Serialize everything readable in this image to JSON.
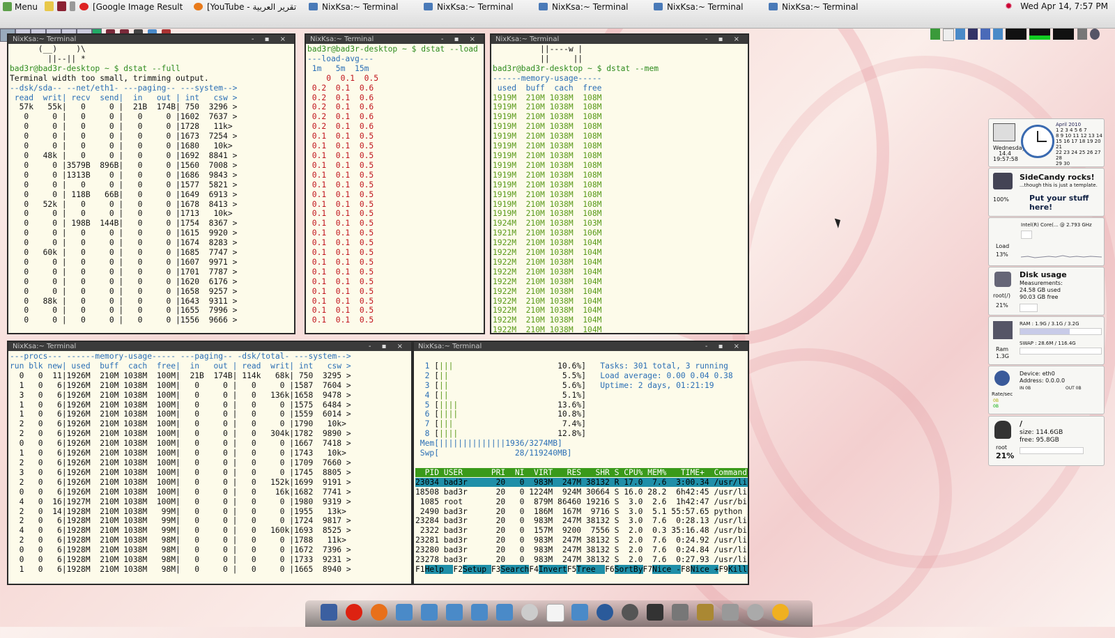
{
  "panel": {
    "menu_label": "Menu",
    "tasks": [
      {
        "label": "[Google Image Result ..."
      },
      {
        "label": "[YouTube - تقرير العربية ..."
      },
      {
        "label": "NixKsa:~ Terminal"
      },
      {
        "label": "NixKsa:~ Terminal"
      },
      {
        "label": "NixKsa:~ Terminal"
      },
      {
        "label": "NixKsa:~ Terminal"
      },
      {
        "label": "NixKsa:~ Terminal"
      }
    ],
    "clock": "Wed Apr 14,  7:57 PM"
  },
  "terminals": {
    "t1": {
      "title": "NixKsa:~ Terminal",
      "lines": [
        "      (__)    )\\",
        "        ||--|| *",
        "bad3r@bad3r-desktop ~ $ dstat --full",
        "Terminal width too small, trimming output.",
        "--dsk/sda-- --net/eth1- ---paging-- ---system-->",
        " read  writ| recv  send|  in   out | int   csw >",
        "  57k   55k|   0     0 |  21B  174B| 750  3296 >",
        "   0     0 |   0     0 |   0     0 |1602  7637 >",
        "   0     0 |   0     0 |   0     0 |1728   11k>",
        "   0     0 |   0     0 |   0     0 |1673  7254 >",
        "   0     0 |   0     0 |   0     0 |1680   10k>",
        "   0   48k |   0     0 |   0     0 |1692  8841 >",
        "   0     0 |3579B  896B|   0     0 |1560  7008 >",
        "   0     0 |1313B    0 |   0     0 |1686  9843 >",
        "   0     0 |   0     0 |   0     0 |1577  5821 >",
        "   0     0 | 118B   66B|   0     0 |1649  6913 >",
        "   0   52k |   0     0 |   0     0 |1678  8413 >",
        "   0     0 |   0     0 |   0     0 |1713   10k>",
        "   0     0 | 198B  144B|   0     0 |1754  8367 >",
        "   0     0 |   0     0 |   0     0 |1615  9920 >",
        "   0     0 |   0     0 |   0     0 |1674  8283 >",
        "   0   60k |   0     0 |   0     0 |1685  7747 >",
        "   0     0 |   0     0 |   0     0 |1607  9971 >",
        "   0     0 |   0     0 |   0     0 |1701  7787 >",
        "   0     0 |   0     0 |   0     0 |1620  6176 >",
        "   0     0 |   0     0 |   0     0 |1658  9257 >",
        "   0   88k |   0     0 |   0     0 |1643  9311 >",
        "   0     0 |   0     0 |   0     0 |1655  7996 >",
        "   0     0 |   0     0 |   0     0 |1556  9666 >"
      ]
    },
    "t2": {
      "title": "NixKsa:~ Terminal",
      "prompt": "bad3r@bad3r-desktop ~ $ dstat --load",
      "header1": "---load-avg---",
      "header2": " 1m   5m  15m ",
      "rows": [
        "   0  0.1  0.5",
        "0.2  0.1  0.6",
        "0.2  0.1  0.6",
        "0.2  0.1  0.6",
        "0.2  0.1  0.6",
        "0.2  0.1  0.6",
        "0.1  0.1  0.5",
        "0.1  0.1  0.5",
        "0.1  0.1  0.5",
        "0.1  0.1  0.5",
        "0.1  0.1  0.5",
        "0.1  0.1  0.5",
        "0.1  0.1  0.5",
        "0.1  0.1  0.5",
        "0.1  0.1  0.5",
        "0.1  0.1  0.5",
        "0.1  0.1  0.5",
        "0.1  0.1  0.5",
        "0.1  0.1  0.5",
        "0.1  0.1  0.5",
        "0.1  0.1  0.5",
        "0.1  0.1  0.5",
        "0.1  0.1  0.5",
        "0.1  0.1  0.5",
        "0.1  0.1  0.5",
        "0.1  0.1  0.5"
      ]
    },
    "t3": {
      "title": "NixKsa:~ Terminal",
      "art1": "          ||----w |",
      "art2": "          ||     ||",
      "prompt": "bad3r@bad3r-desktop ~ $ dstat --mem",
      "header1": "------memory-usage-----",
      "header2": " used  buff  cach  free",
      "rows": [
        "1919M  210M 1038M  108M",
        "1919M  210M 1038M  108M",
        "1919M  210M 1038M  108M",
        "1919M  210M 1038M  108M",
        "1919M  210M 1038M  108M",
        "1919M  210M 1038M  108M",
        "1919M  210M 1038M  108M",
        "1919M  210M 1038M  108M",
        "1919M  210M 1038M  108M",
        "1919M  210M 1038M  108M",
        "1919M  210M 1038M  108M",
        "1919M  210M 1038M  108M",
        "1919M  210M 1038M  108M",
        "1924M  210M 1038M  103M",
        "1921M  210M 1038M  106M",
        "1922M  210M 1038M  104M",
        "1922M  210M 1038M  104M",
        "1922M  210M 1038M  104M",
        "1922M  210M 1038M  104M",
        "1922M  210M 1038M  104M",
        "1922M  210M 1038M  104M",
        "1922M  210M 1038M  104M",
        "1922M  210M 1038M  104M",
        "1922M  210M 1038M  104M",
        "1922M  210M 1038M  104M",
        "1922M  210M 1038M  104M"
      ]
    },
    "t4": {
      "title": "NixKsa:~ Terminal",
      "header1": "---procs--- ------memory-usage----- ---paging-- -dsk/total- ---system-->",
      "header2": "run blk new| used  buff  cach  free|  in   out | read  writ| int   csw >",
      "rows": [
        "  0   0  11|1926M  210M 1038M  100M|  21B  174B| 114k   68k| 750  3295 >",
        "  1   0   6|1926M  210M 1038M  100M|   0     0 |   0     0 |1587  7604 >",
        "  3   0   6|1926M  210M 1038M  100M|   0     0 |   0   136k|1658  9478 >",
        "  1   0   6|1926M  210M 1038M  100M|   0     0 |   0     0 |1575  6484 >",
        "  1   0   6|1926M  210M 1038M  100M|   0     0 |   0     0 |1559  6014 >",
        "  2   0   6|1926M  210M 1038M  100M|   0     0 |   0     0 |1790   10k>",
        "  2   0   6|1926M  210M 1038M  100M|   0     0 |   0   304k|1782  9890 >",
        "  0   0   6|1926M  210M 1038M  100M|   0     0 |   0     0 |1667  7418 >",
        "  1   0   6|1926M  210M 1038M  100M|   0     0 |   0     0 |1743   10k>",
        "  2   0   6|1926M  210M 1038M  100M|   0     0 |   0     0 |1709  7660 >",
        "  3   0   6|1926M  210M 1038M  100M|   0     0 |   0     0 |1745  8805 >",
        "  2   0   6|1926M  210M 1038M  100M|   0     0 |   0   152k|1699  9191 >",
        "  0   0   6|1926M  210M 1038M  100M|   0     0 |   0    16k|1682  7741 >",
        "  4   0  16|1927M  210M 1038M  100M|   0     0 |   0     0 |1980  9319 >",
        "  2   0  14|1928M  210M 1038M   99M|   0     0 |   0     0 |1955   13k>",
        "  2   0   6|1928M  210M 1038M   99M|   0     0 |   0     0 |1724  9817 >",
        "  4   0   6|1928M  210M 1038M   99M|   0     0 |   0   160k|1693  8525 >",
        "  2   0   6|1928M  210M 1038M   98M|   0     0 |   0     0 |1788   11k>",
        "  0   0   6|1928M  210M 1038M   98M|   0     0 |   0     0 |1672  7396 >",
        "  0   0   6|1928M  210M 1038M   98M|   0     0 |   0     0 |1733  9231 >",
        "  1   0   6|1928M  210M 1038M   98M|   0     0 |   0     0 |1665  8940 >"
      ]
    },
    "t5": {
      "title": "NixKsa:~ Terminal",
      "cpus": [
        {
          "n": " 1",
          "bar": "[|||",
          "pct": "10.6%]"
        },
        {
          "n": " 2",
          "bar": "[||",
          "pct": "5.5%]"
        },
        {
          "n": " 3",
          "bar": "[||",
          "pct": "5.6%]"
        },
        {
          "n": " 4",
          "bar": "[||",
          "pct": "5.1%]"
        },
        {
          "n": " 5",
          "bar": "[||||",
          "pct": "13.6%]"
        },
        {
          "n": " 6",
          "bar": "[||||",
          "pct": "10.8%]"
        },
        {
          "n": " 7",
          "bar": "[|||",
          "pct": "7.4%]"
        },
        {
          "n": " 8",
          "bar": "[||||",
          "pct": "12.8%]"
        }
      ],
      "mem_bar": " Mem[||||||||||||||1936/3274MB]",
      "swp_bar": " Swp[                28/119240MB]",
      "tasks_line": "Tasks: 301 total, 3 running",
      "load_line": "Load average: 0.00 0.04 0.38",
      "uptime_line": "Uptime: 2 days, 01:21:19",
      "proc_header": "  PID USER      PRI  NI  VIRT   RES   SHR S CPU% MEM%   TIME+  Command",
      "procs": [
        "23034 bad3r      20   0  983M  247M 38132 R 17.0  7.6  3:00.34 /usr/lib/f",
        "18508 bad3r      20   0 1224M  924M 30664 S 16.0 28.2  6h42:45 /usr/lib/o",
        " 1085 root       20   0  879M 86460 19216 S  3.0  2.6  1h42:47 /usr/bin/X",
        " 2490 bad3r      20   0  186M  167M  9716 S  3.0  5.1 55:57.65 python /us",
        "23284 bad3r      20   0  983M  247M 38132 S  3.0  7.6  0:28.13 /usr/lib/f",
        " 2322 bad3r      20   0  157M  9200  7556 S  2.0  0.3 35:16.48 /usr/bin/p",
        "23281 bad3r      20   0  983M  247M 38132 S  2.0  7.6  0:24.92 /usr/lib/f",
        "23280 bad3r      20   0  983M  247M 38132 S  2.0  7.6  0:24.84 /usr/lib/f",
        "23278 bad3r      20   0  983M  247M 38132 S  2.0  7.6  0:27.93 /usr/lib/f"
      ],
      "footer": [
        {
          "key": "F1",
          "label": "Help  "
        },
        {
          "key": "F2",
          "label": "Setup "
        },
        {
          "key": "F3",
          "label": "Search"
        },
        {
          "key": "F4",
          "label": "Invert"
        },
        {
          "key": "F5",
          "label": "Tree  "
        },
        {
          "key": "F6",
          "label": "SortBy"
        },
        {
          "key": "F7",
          "label": "Nice -"
        },
        {
          "key": "F8",
          "label": "Nice +"
        },
        {
          "key": "F9",
          "label": "Kill  "
        }
      ]
    }
  },
  "widgets": {
    "calendar": {
      "day": "Wednesday",
      "date": "14.4",
      "time": "19:57:58",
      "month": "April 2010",
      "days": [
        "1 2 3 4 5 6 7",
        "8 9 10 11 12 13 14",
        "15 16 17 18 19 20 21",
        "22 23 24 25 26 27 28",
        "29 30"
      ]
    },
    "sidecandy": {
      "title": "SideCandy rocks!",
      "subtitle": "...though this is just a template.",
      "cta": "Put your stuff here!",
      "pct": "100%"
    },
    "cpu": {
      "model": "Intel(R) Core(... @ 2.793 GHz",
      "label": "Load",
      "pct": "13%"
    },
    "disk": {
      "title": "Disk usage",
      "meas": "Measurements:",
      "used": "24.58 GB used",
      "free": "90.03 GB free",
      "mount": "root(/)",
      "pct": "21%"
    },
    "ram": {
      "ram": "RAM : 1.9G / 3.1G / 3.2G",
      "swap": "SWAP : 28.6M / 116.4G",
      "label": "Ram",
      "val": "1.3G"
    },
    "net": {
      "device": "Device: eth0",
      "address": "Address: 0.0.0.0",
      "in": "IN 0B",
      "out": "OUT 0B",
      "label": "Rate/sec",
      "v1": "0B",
      "v2": "0B"
    },
    "root": {
      "path": "/",
      "size": "size: 114.6GB",
      "free": "free: 95.8GB",
      "label": "root",
      "pct": "21%"
    }
  }
}
